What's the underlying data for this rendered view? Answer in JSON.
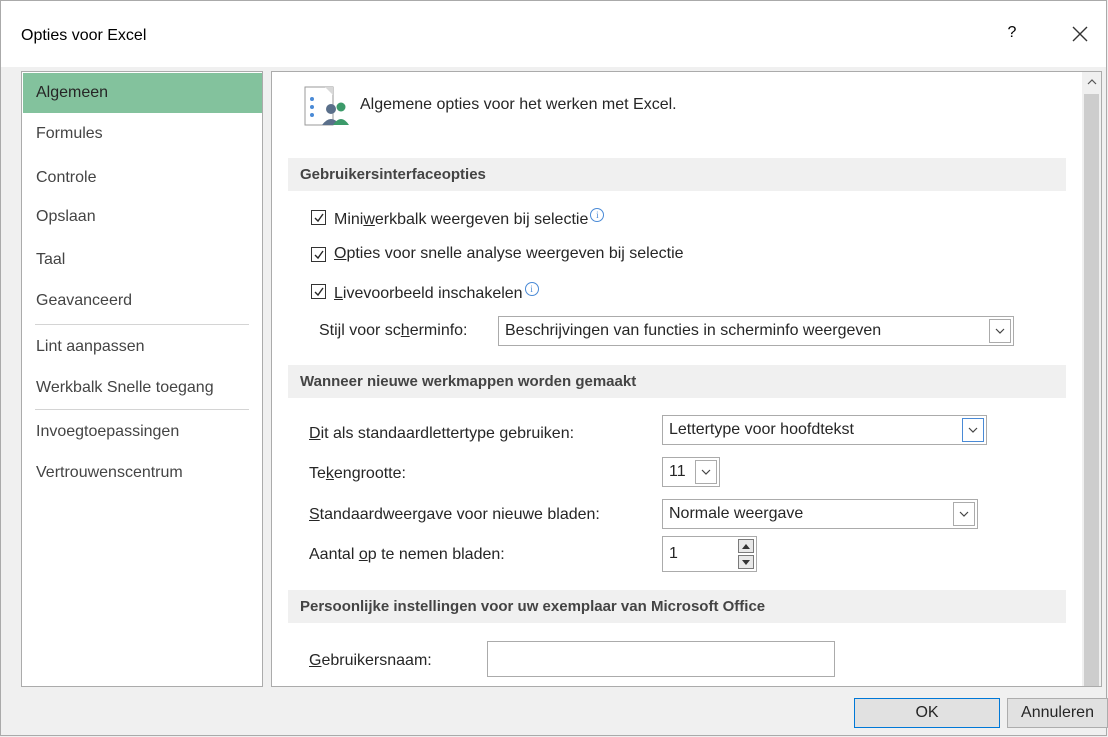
{
  "window": {
    "title": "Opties voor Excel",
    "help_label": "?"
  },
  "nav": {
    "items": [
      {
        "label": "Algemeen",
        "selected": true
      },
      {
        "label": "Formules"
      },
      {
        "label": "Controle"
      },
      {
        "label": "Opslaan"
      },
      {
        "label": "Taal"
      },
      {
        "label": "Geavanceerd"
      },
      {
        "label": "Lint aanpassen"
      },
      {
        "label": "Werkbalk Snelle toegang"
      },
      {
        "label": "Invoegtoepassingen"
      },
      {
        "label": "Vertrouwenscentrum"
      }
    ]
  },
  "main": {
    "header": "Algemene opties voor het werken met Excel.",
    "header_icon": "general-options-icon",
    "section_ui": {
      "title": "Gebruikersinterfaceopties",
      "opt1_pre": "Mini",
      "opt1_u": "w",
      "opt1_post": "erkbalk weergeven bij selectie",
      "opt2_pre": "",
      "opt2_u": "O",
      "opt2_post": "pties voor snelle analyse weergeven bij selectie",
      "opt3_pre": "",
      "opt3_u": "L",
      "opt3_post": "ivevoorbeeld inschakelen",
      "screentip_label_pre": "Stijl voor sc",
      "screentip_label_u": "h",
      "screentip_label_post": "erminfo:",
      "screentip_value": "Beschrijvingen van functies in scherminfo weergeven",
      "info_glyph": "i"
    },
    "section_new": {
      "title": "Wanneer nieuwe werkmappen worden gemaakt",
      "font_label_u": "D",
      "font_label_post": "it als standaardlettertype gebruiken:",
      "font_value": "Lettertype voor hoofdtekst",
      "size_label_pre": "Te",
      "size_label_u": "k",
      "size_label_post": "engrootte:",
      "size_value": "11",
      "view_label_u": "S",
      "view_label_post": "tandaardweergave voor nieuwe bladen:",
      "view_value": "Normale weergave",
      "sheets_label_pre": "Aantal ",
      "sheets_label_u": "o",
      "sheets_label_post": "p te nemen bladen:",
      "sheets_value": "1"
    },
    "section_personal": {
      "title": "Persoonlijke instellingen voor uw exemplaar van Microsoft Office",
      "username_label_u": "G",
      "username_label_post": "ebruikersnaam:",
      "username_value": ""
    }
  },
  "footer": {
    "ok_label": "OK",
    "cancel_label": "Annuleren"
  }
}
